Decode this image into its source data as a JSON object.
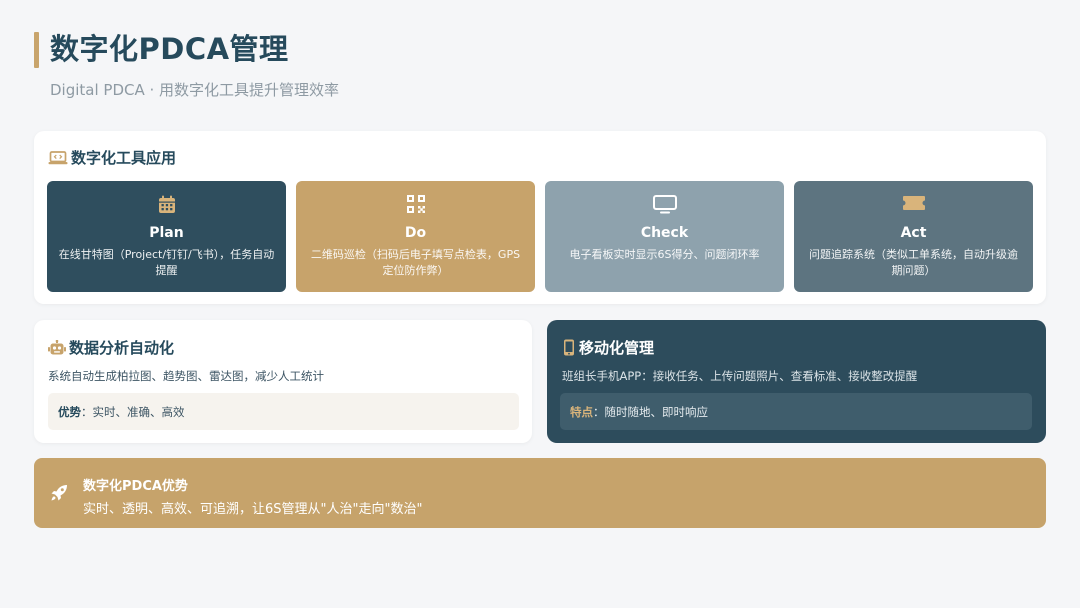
{
  "header": {
    "title": "数字化PDCA管理",
    "subtitle": "Digital PDCA · 用数字化工具提升管理效率"
  },
  "tools": {
    "heading": "数字化工具应用",
    "heading_icon": "laptop-code-icon",
    "boxes": [
      {
        "name": "Plan",
        "icon": "calendar-icon",
        "desc": "在线甘特图（Project/钉钉/飞书），任务自动提醒",
        "color": "#2f4e5e"
      },
      {
        "name": "Do",
        "icon": "qrcode-icon",
        "desc": "二维码巡检（扫码后电子填写点检表，GPS定位防作弊）",
        "color": "#c7a36b"
      },
      {
        "name": "Check",
        "icon": "monitor-icon",
        "desc": "电子看板实时显示6S得分、问题闭环率",
        "color": "#8ea2ad"
      },
      {
        "name": "Act",
        "icon": "ticket-icon",
        "desc": "问题追踪系统（类似工单系统，自动升级逾期问题）",
        "color": "#5d7480"
      }
    ]
  },
  "analysis": {
    "heading": "数据分析自动化",
    "heading_icon": "robot-icon",
    "desc": "系统自动生成柏拉图、趋势图、雷达图，减少人工统计",
    "highlight_label": "优势",
    "highlight_text": "：实时、准确、高效"
  },
  "mobile": {
    "heading": "移动化管理",
    "heading_icon": "mobile-phone-icon",
    "desc": "班组长手机APP：接收任务、上传问题照片、查看标准、接收整改提醒",
    "highlight_label": "特点",
    "highlight_text": "：随时随地、即时响应"
  },
  "advantage": {
    "icon": "rocket-icon",
    "title": "数字化PDCA优势",
    "text": "实时、透明、高效、可追溯，让6S管理从\"人治\"走向\"数治\""
  },
  "colors": {
    "accent_gold": "#c7a36b",
    "navy": "#2d4c5c",
    "background": "#f5f6f8"
  }
}
